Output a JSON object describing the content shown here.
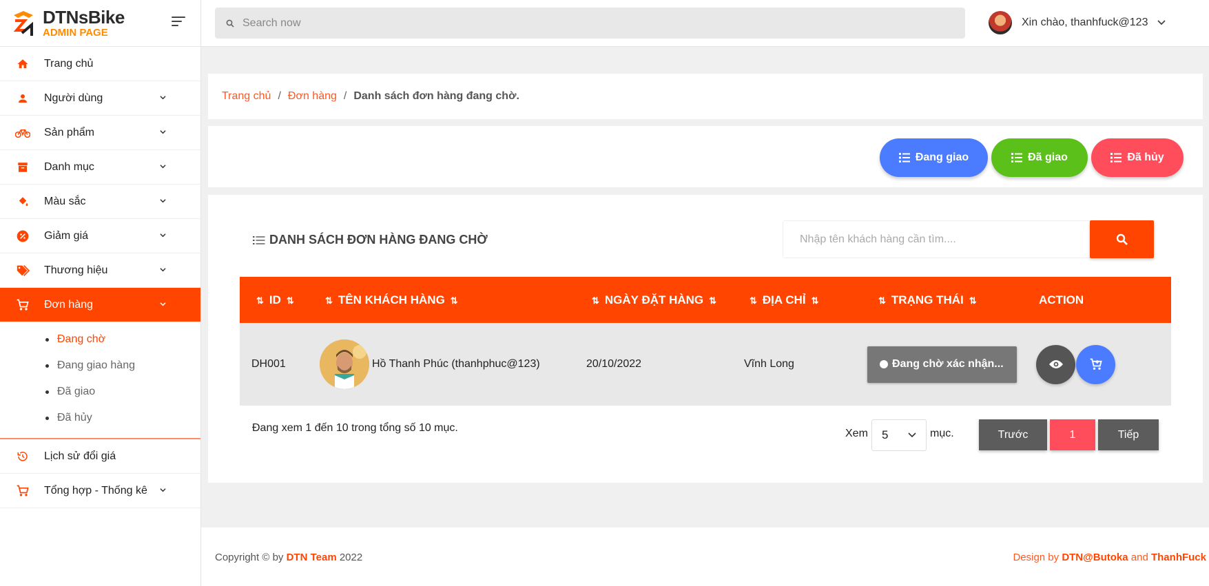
{
  "brand": {
    "name": "DTNsBike",
    "sub": "ADMIN PAGE"
  },
  "topbar": {
    "search_placeholder": "Search now",
    "greeting": "Xin chào, thanhfuck@123"
  },
  "sidebar": {
    "items": [
      {
        "label": "Trang chủ",
        "icon": "home-icon"
      },
      {
        "label": "Người dùng",
        "icon": "user-icon"
      },
      {
        "label": "Sản phẩm",
        "icon": "bicycle-icon"
      },
      {
        "label": "Danh mục",
        "icon": "archive-icon"
      },
      {
        "label": "Màu sắc",
        "icon": "paint-bucket-icon"
      },
      {
        "label": "Giảm giá",
        "icon": "discount-icon"
      },
      {
        "label": "Thương hiệu",
        "icon": "tags-icon"
      },
      {
        "label": "Đơn hàng",
        "icon": "cart-icon"
      }
    ],
    "submenu": [
      "Đang chờ",
      "Đang giao hàng",
      "Đã giao",
      "Đã hủy"
    ],
    "bottom_items": [
      {
        "label": "Lịch sử đổi giá",
        "icon": "history-icon"
      },
      {
        "label": "Tổng hợp - Thống kê",
        "icon": "cart-icon"
      }
    ]
  },
  "breadcrumb": {
    "home": "Trang chủ",
    "orders": "Đơn hàng",
    "current": "Danh sách đơn hàng đang chờ."
  },
  "status_buttons": {
    "shipping": "Đang giao",
    "delivered": "Đã giao",
    "cancelled": "Đã hủy"
  },
  "list": {
    "title": "DANH SÁCH ĐƠN HÀNG ĐANG CHỜ",
    "search_placeholder": "Nhập tên khách hàng cần tìm....",
    "columns": [
      "ID",
      "TÊN KHÁCH HÀNG",
      "NGÀY ĐẶT HÀNG",
      "ĐỊA CHỈ",
      "TRẠNG THÁI",
      "ACTION"
    ],
    "rows": [
      {
        "id": "DH001",
        "customer": "Hồ Thanh Phúc (thanhphuc@123)",
        "date": "20/10/2022",
        "address": "Vĩnh Long",
        "status": "Đang chờ xác nhận..."
      }
    ],
    "info": "Đang xem 1 đến 10 trong tổng số 10 mục.",
    "show_label": "Xem",
    "page_size": "5",
    "entries_label": "mục.",
    "prev": "Trước",
    "page": "1",
    "next": "Tiếp"
  },
  "footer": {
    "copy_prefix": "Copyright © by ",
    "team": "DTN Team",
    "year": " 2022",
    "design_prefix": "Design by ",
    "designer1": "DTN@Butoka",
    "and": " and ",
    "designer2": "ThanhFuck"
  },
  "colors": {
    "accent": "#ff4500",
    "blue": "#4b7cff",
    "green": "#5cc01a",
    "red": "#ff4d5c"
  }
}
